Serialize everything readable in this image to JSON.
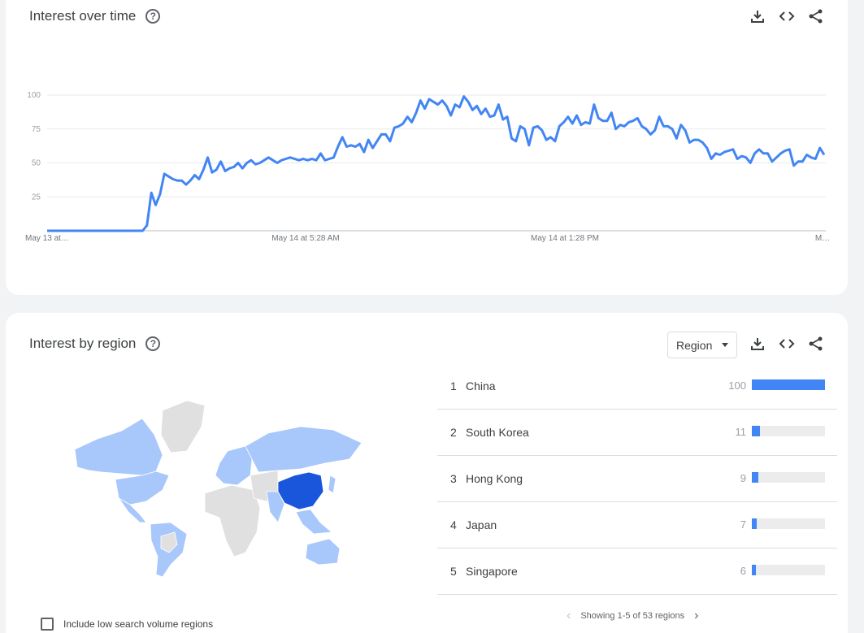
{
  "interest_over_time": {
    "title": "Interest over time",
    "help_icon": "help-circle-icon",
    "toolbar": {
      "download_icon": "download-icon",
      "embed_icon": "embed-code-icon",
      "share_icon": "share-icon"
    },
    "chart_data": {
      "type": "line",
      "ylim": [
        0,
        100
      ],
      "yticks": [
        "100",
        "75",
        "50",
        "25"
      ],
      "xticks": [
        "May 13 at…",
        "May 14 at 5:28 AM",
        "May 14 at 1:28 PM",
        "M…"
      ],
      "grid": true,
      "color": "#4285f4",
      "series": [
        {
          "values": [
            0,
            0,
            0,
            0,
            0,
            0,
            0,
            0,
            0,
            0,
            0,
            0,
            0,
            0,
            0,
            0,
            0,
            0,
            0,
            0,
            0,
            0,
            0,
            4,
            28,
            19,
            27,
            42,
            40,
            38,
            37,
            37,
            34,
            37,
            41,
            38,
            45,
            54,
            43,
            45,
            51,
            44,
            46,
            47,
            50,
            46,
            50,
            52,
            49,
            50,
            52,
            54,
            52,
            50,
            52,
            53,
            54,
            53,
            52,
            53,
            52,
            53,
            52,
            57,
            52,
            53,
            54,
            62,
            69,
            62,
            63,
            62,
            64,
            58,
            67,
            61,
            66,
            71,
            71,
            66,
            76,
            77,
            79,
            84,
            80,
            87,
            96,
            90,
            97,
            95,
            93,
            96,
            92,
            85,
            93,
            91,
            99,
            95,
            89,
            92,
            86,
            90,
            84,
            85,
            93,
            82,
            84,
            68,
            66,
            77,
            75,
            63,
            76,
            77,
            74,
            67,
            69,
            66,
            77,
            80,
            84,
            79,
            85,
            78,
            80,
            79,
            93,
            83,
            81,
            81,
            87,
            75,
            78,
            77,
            80,
            81,
            83,
            77,
            75,
            71,
            74,
            84,
            77,
            77,
            75,
            68,
            78,
            74,
            65,
            67,
            67,
            65,
            61,
            53,
            57,
            56,
            58,
            59,
            60,
            53,
            55,
            54,
            50,
            57,
            60,
            57,
            57,
            51,
            54,
            57,
            59,
            60,
            48,
            51,
            51,
            56,
            54,
            53,
            61,
            56
          ]
        }
      ]
    }
  },
  "interest_by_region": {
    "title": "Interest by region",
    "help_icon": "help-circle-icon",
    "select_value": "Region",
    "toolbar": {
      "download_icon": "download-icon",
      "embed_icon": "embed-code-icon",
      "share_icon": "share-icon"
    },
    "rows": [
      {
        "rank": "1",
        "name": "China",
        "value": "100",
        "pct": 100
      },
      {
        "rank": "2",
        "name": "South Korea",
        "value": "11",
        "pct": 11
      },
      {
        "rank": "3",
        "name": "Hong Kong",
        "value": "9",
        "pct": 9
      },
      {
        "rank": "4",
        "name": "Japan",
        "value": "7",
        "pct": 7
      },
      {
        "rank": "5",
        "name": "Singapore",
        "value": "6",
        "pct": 6
      }
    ],
    "pager_text": "Showing 1-5 of 53 regions",
    "low_volume_label": "Include low search volume regions",
    "map_colors": {
      "high": "#1a56db",
      "mid": "#a8c7fa",
      "none": "#e0e0e0"
    }
  }
}
